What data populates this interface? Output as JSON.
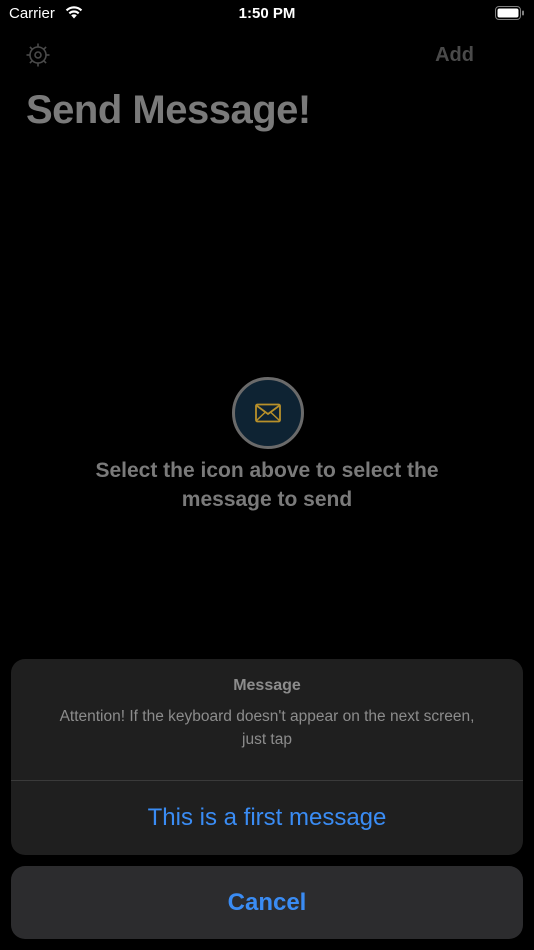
{
  "status_bar": {
    "carrier": "Carrier",
    "time": "1:50 PM"
  },
  "nav": {
    "add_label": "Add",
    "settings_icon": "gear-icon"
  },
  "page": {
    "title": "Send Message!"
  },
  "center": {
    "icon": "envelope-icon",
    "hint": "Select the icon above to select the message to send"
  },
  "action_sheet": {
    "title": "Message",
    "message": "Attention! If the keyboard doesn't appear on the next screen, just tap",
    "actions": [
      {
        "label": "This is a first message"
      }
    ],
    "cancel_label": "Cancel"
  },
  "colors": {
    "accent": "#3a8cf4",
    "icon_gold": "#b8902a",
    "background": "#000000",
    "sheet_bg": "#1f1f1f"
  }
}
